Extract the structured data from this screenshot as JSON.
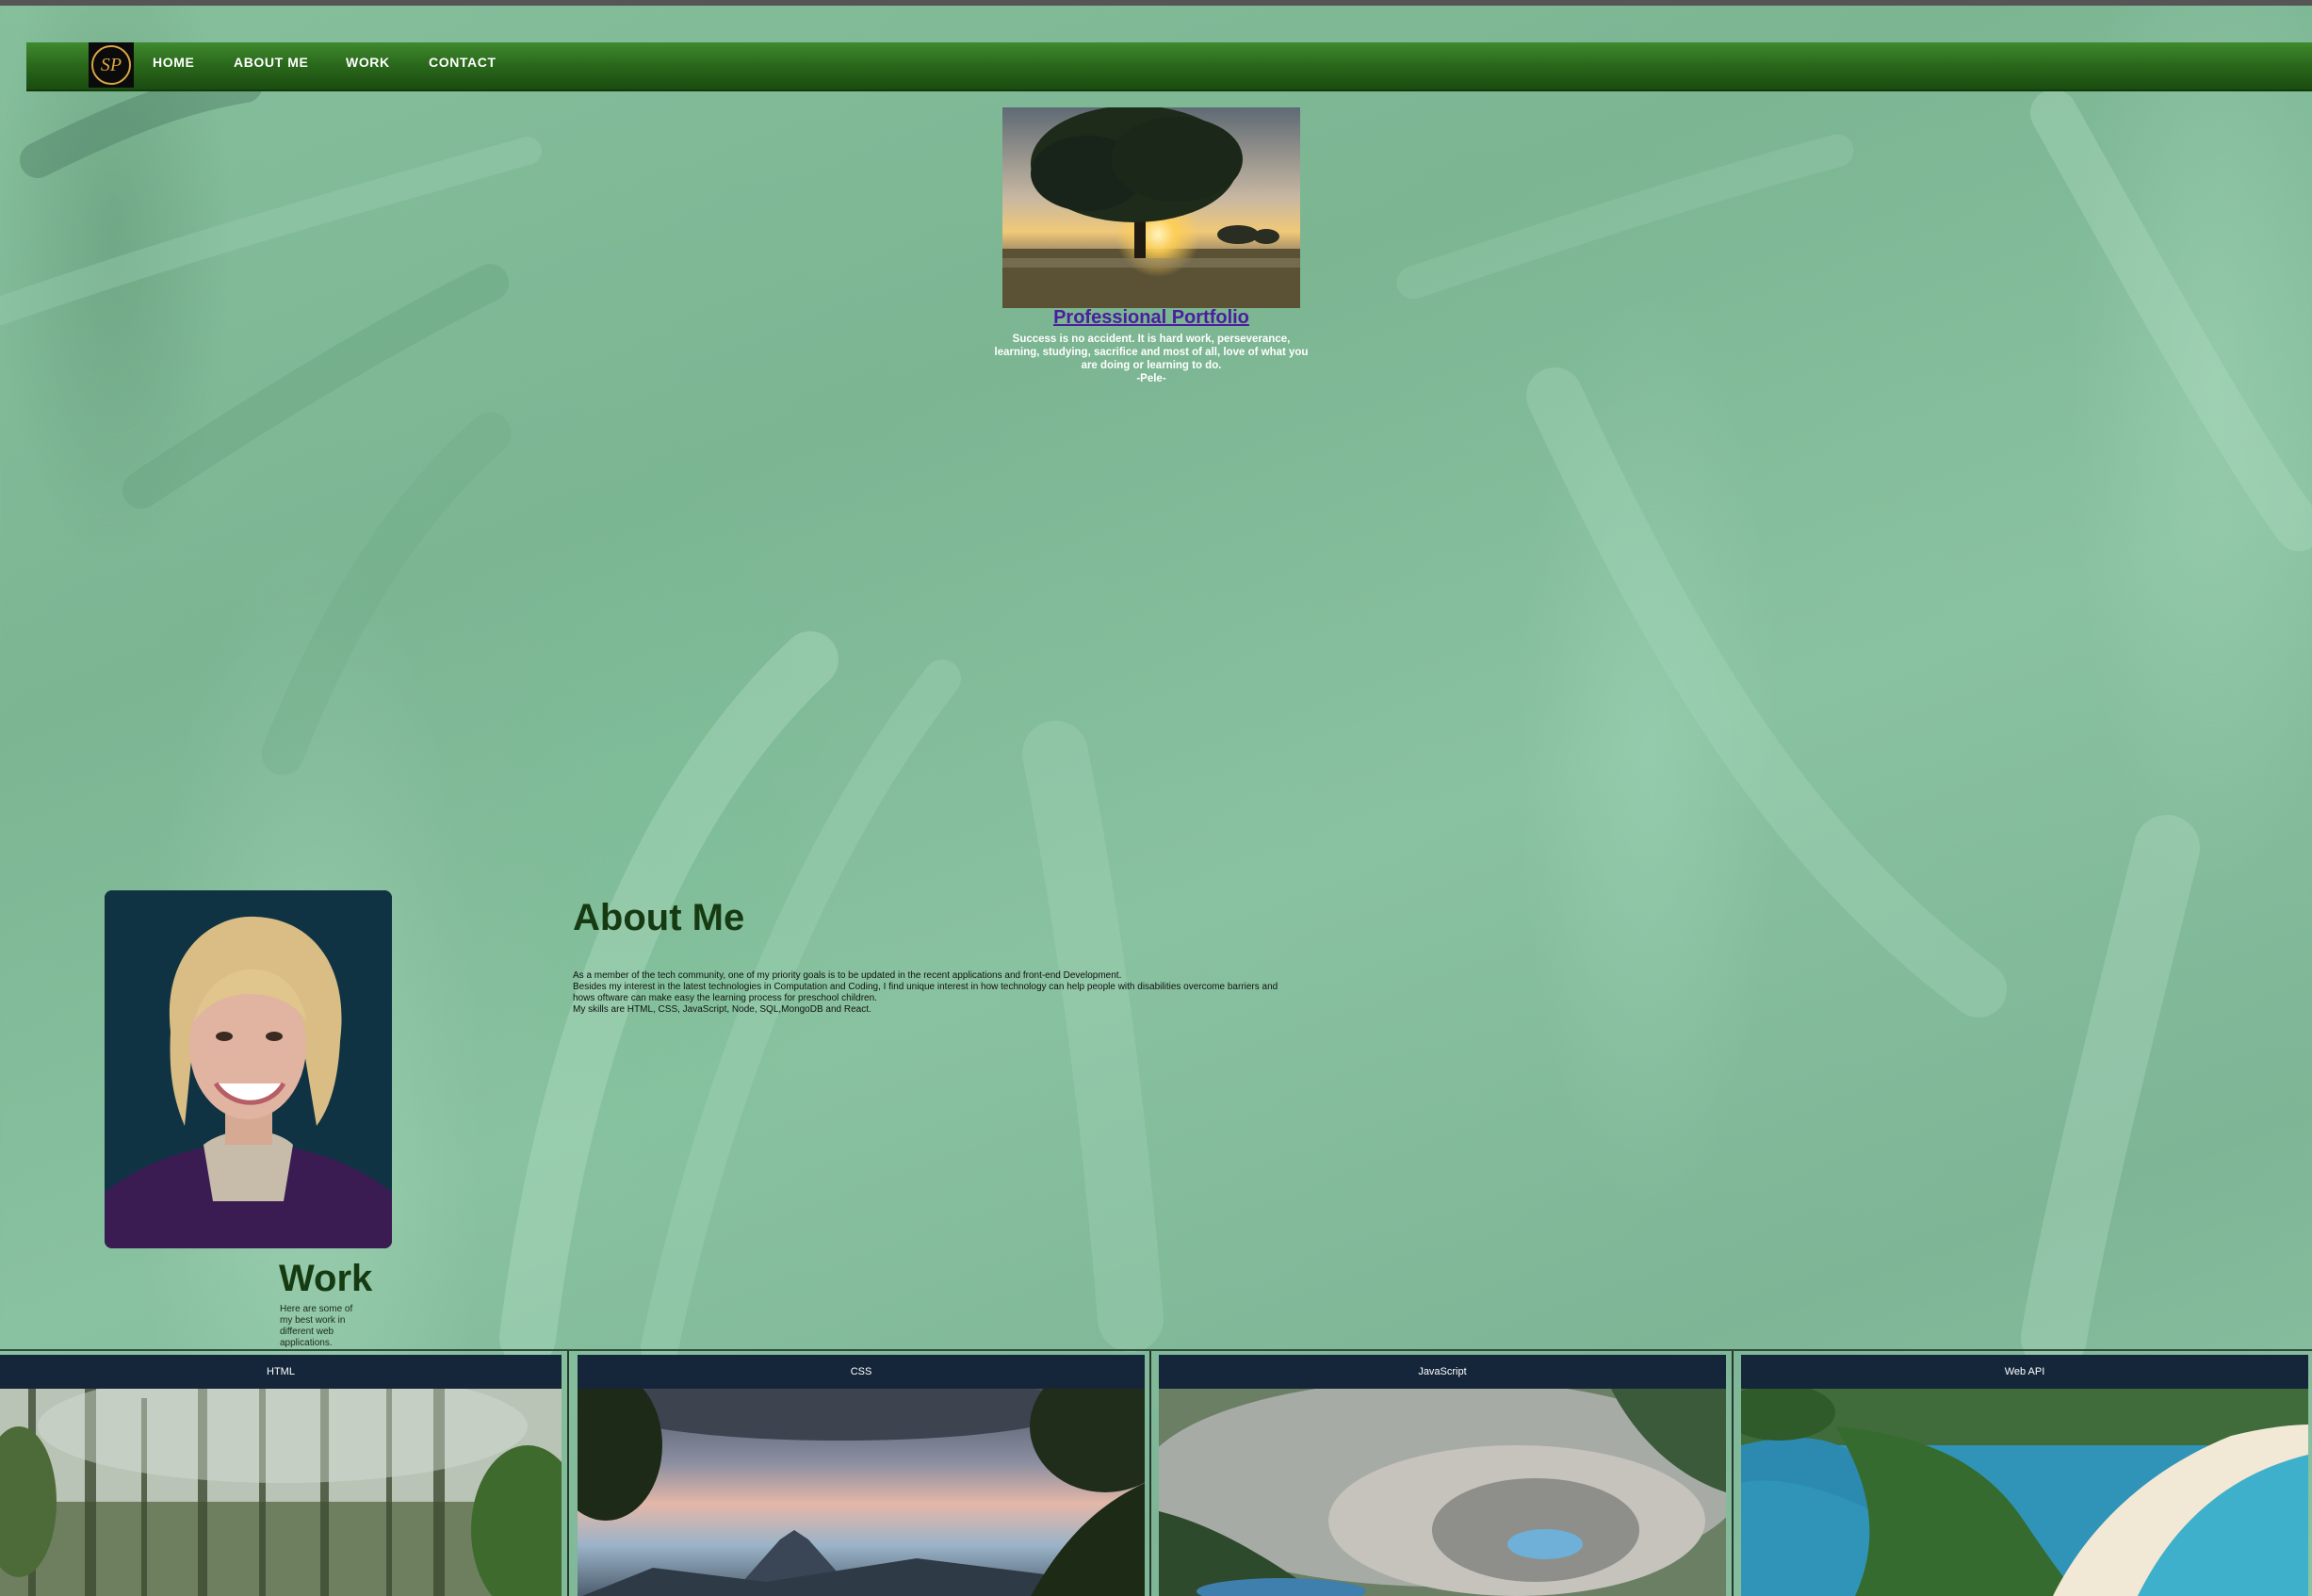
{
  "nav": {
    "logo_text": "SP",
    "items": [
      {
        "label": "HOME"
      },
      {
        "label": "ABOUT ME"
      },
      {
        "label": "WORK"
      },
      {
        "label": "CONTACT"
      }
    ]
  },
  "hero": {
    "image_alt": "tree at sunrise",
    "title": "Professional Portfolio",
    "quote": "Success is no accident. It is hard work, perseverance, learning, studying, sacrifice and most of all, love of what you are doing or learning to do.",
    "author": "-Pele-"
  },
  "about": {
    "title": "About Me",
    "lines": [
      "As a member of the tech community, one of my priority goals is to be updated in the recent applications and front-end Development.",
      "Besides my interest in the latest technologies in Computation and Coding, I find unique interest in how technology can help people with disabilities overcome barriers and hows oftware can make easy the learning process for preschool children.",
      "My skills are HTML, CSS, JavaScript, Node, SQL,MongoDB and React."
    ]
  },
  "work": {
    "title": "Work",
    "description": "Here are some of my best work in different web applications."
  },
  "cards": [
    {
      "label": "HTML",
      "image": "misty-forest"
    },
    {
      "label": "CSS",
      "image": "volcano-sunset"
    },
    {
      "label": "JavaScript",
      "image": "crater-lake"
    },
    {
      "label": "Web API",
      "image": "tropical-beach"
    }
  ],
  "colors": {
    "nav": "#2b6a1c",
    "title_link": "#4b1da0",
    "heading": "#163a12",
    "card_head": "#15263a"
  }
}
